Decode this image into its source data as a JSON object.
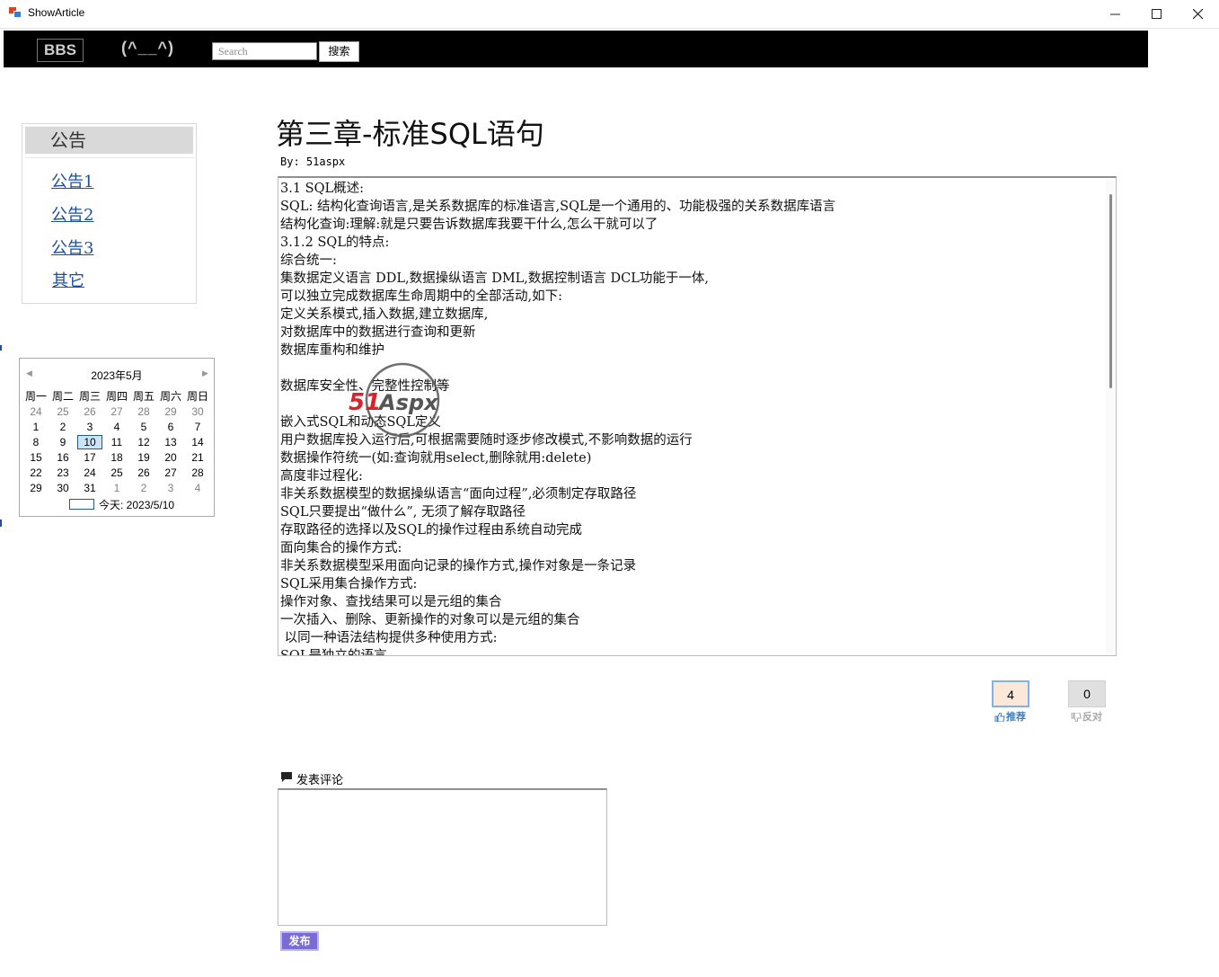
{
  "window": {
    "title": "ShowArticle"
  },
  "navbar": {
    "brand": "BBS",
    "tagline": "(^__^)",
    "search_placeholder": "Search",
    "search_button": "搜索"
  },
  "sidebar": {
    "notice_header": "公告",
    "links": [
      {
        "label": "公告1"
      },
      {
        "label": "公告2"
      },
      {
        "label": "公告3"
      },
      {
        "label": "其它"
      }
    ]
  },
  "calendar": {
    "title": "2023年5月",
    "weekdays": [
      "周一",
      "周二",
      "周三",
      "周四",
      "周五",
      "周六",
      "周日"
    ],
    "weeks": [
      [
        "24",
        "25",
        "26",
        "27",
        "28",
        "29",
        "30"
      ],
      [
        "1",
        "2",
        "3",
        "4",
        "5",
        "6",
        "7"
      ],
      [
        "8",
        "9",
        "10",
        "11",
        "12",
        "13",
        "14"
      ],
      [
        "15",
        "16",
        "17",
        "18",
        "19",
        "20",
        "21"
      ],
      [
        "22",
        "23",
        "24",
        "25",
        "26",
        "27",
        "28"
      ],
      [
        "29",
        "30",
        "31",
        "1",
        "2",
        "3",
        "4"
      ]
    ],
    "selected_day": "10",
    "today_label": "今天: 2023/5/10"
  },
  "article": {
    "title": "第三章-标准SQL语句",
    "author": "By: 51aspx",
    "lines": [
      "3.1 SQL概述:",
      "SQL: 结构化查询语言,是关系数据库的标准语言,SQL是一个通用的、功能极强的关系数据库语言",
      "结构化查询:理解:就是只要告诉数据库我要干什么,怎么干就可以了",
      "3.1.2 SQL的特点:",
      "综合统一:",
      "集数据定义语言 DDL,数据操纵语言 DML,数据控制语言 DCL功能于一体,",
      "可以独立完成数据库生命周期中的全部活动,如下:",
      "定义关系模式,插入数据,建立数据库,",
      "对数据库中的数据进行查询和更新",
      "数据库重构和维护",
      "",
      "数据库安全性、完整性控制等",
      "",
      "嵌入式SQL和动态SQL定义",
      "用户数据库投入运行后,可根据需要随时逐步修改模式,不影响数据的运行",
      "数据操作符统一(如:查询就用select,删除就用:delete)",
      "高度非过程化:",
      "非关系数据模型的数据操纵语言“面向过程”,必须制定存取路径",
      "SQL只要提出“做什么”, 无须了解存取路径",
      "存取路径的选择以及SQL的操作过程由系统自动完成",
      "面向集合的操作方式:",
      "非关系数据模型采用面向记录的操作方式,操作对象是一条记录",
      "SQL采用集合操作方式:",
      "操作对象、查找结果可以是元组的集合",
      "一次插入、删除、更新操作的对象可以是元组的集合",
      " 以同一种语法结构提供多种使用方式:",
      "SQL是独立的语言"
    ]
  },
  "watermark": {
    "text": "51Aspx"
  },
  "votes": {
    "recommend_count": "4",
    "recommend_label": "推荐",
    "oppose_count": "0",
    "oppose_label": "反对"
  },
  "comment": {
    "heading": "发表评论",
    "value": "",
    "publish_button": "发布"
  },
  "colors": {
    "navbar_bg": "#000000",
    "link": "#1a4fa0",
    "publish_bg": "#7b6bd6",
    "recommend_bg": "#fbe8d8",
    "oppose_bg": "#e0e0e0",
    "watermark_red": "#d9232a"
  }
}
